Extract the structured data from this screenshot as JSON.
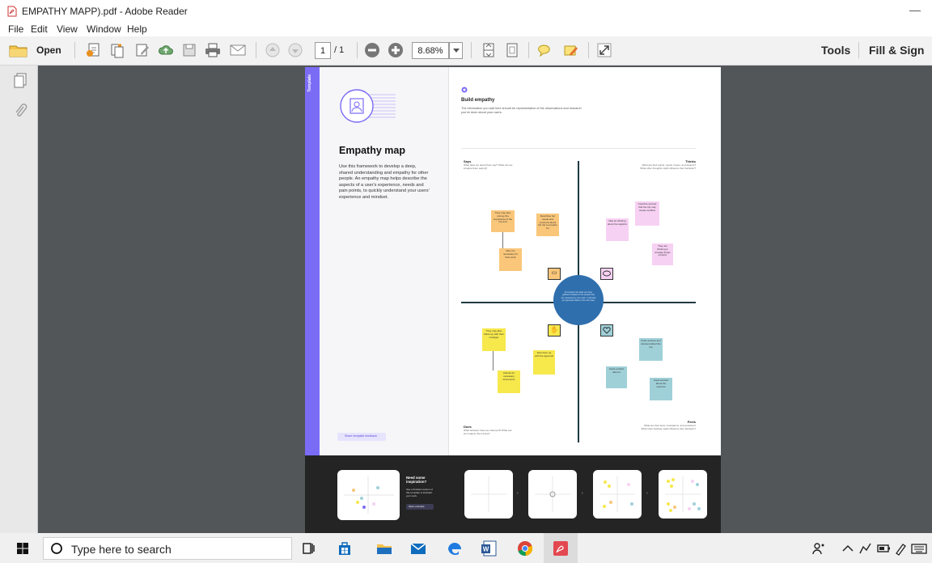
{
  "window": {
    "title": "EMPATHY MAPP).pdf - Adobe Reader",
    "minimize": "—"
  },
  "menu": [
    "File",
    "Edit",
    "View",
    "Window",
    "Help"
  ],
  "toolbar": {
    "open_label": "Open",
    "page_current": "1",
    "page_total": "/ 1",
    "zoom": "8.68%",
    "tools_label": "Tools",
    "fill_sign_label": "Fill & Sign"
  },
  "page": {
    "template_tab": "Template",
    "heading": "Empathy map",
    "description": "Use this framework to develop a deep, shared understanding and empathy for other people. An empathy map helps describe the aspects of a user's experience, needs and pain points, to quickly understand your users' experience and mindset.",
    "feedback": "Share template feedback",
    "inspire_title": "Need some inspiration?",
    "inspire_text": "See a finished version of this template to kickstart your work.",
    "inspire_button": "Open example",
    "step_title": "Build empathy",
    "step_text": "The information you add here should be representative of the observations and research you've done about your users.",
    "q_says": "Says",
    "q_says_sub": "What have we heard them say? What can we imagine them saying?",
    "q_thinks": "Thinks",
    "q_thinks_sub": "What are their wants, needs, hopes, and dreams? What other thoughts might influence their behavior?",
    "q_does": "Does",
    "q_does_sub": "What behavior have we observed? What can we imagine them doing?",
    "q_feels": "Feels",
    "q_feels_sub": "What are their fears, frustrations, and anxieties? What other feelings might influence their behavior?",
    "center_text": "Summarize the data you have gathered related to the people that are impacted by your work. It will help you generate ideas in the next step.",
    "notes_says": [
      "They may also convey the importance of the trip and",
      "Describes her needs and concerns about the trip to prepare for",
      "Why it is necessary for their work"
    ],
    "notes_thinks": [
      "Could be worried that the trip may create conflicts",
      "May be thinking about the logistics",
      "They are thinking to arrange things properly"
    ],
    "notes_does": [
      "They may also follow up with their manager",
      "Sets them up with the approval",
      "Checks for necessary documents"
    ],
    "notes_feels": [
      "Feels anxious and stressed about the trip",
      "Feels excited about it",
      "Feels worried about the outcome"
    ]
  },
  "taskbar": {
    "search_placeholder": "Type here to search"
  },
  "colors": {
    "accent_purple": "#7b6cf6",
    "center_blue": "#2f6fae",
    "sticky_orange": "#f9c67a",
    "sticky_yellow": "#f7e84c",
    "sticky_pink": "#f7d1f3",
    "sticky_teal": "#9fd0d8",
    "dark_band": "#242424"
  }
}
